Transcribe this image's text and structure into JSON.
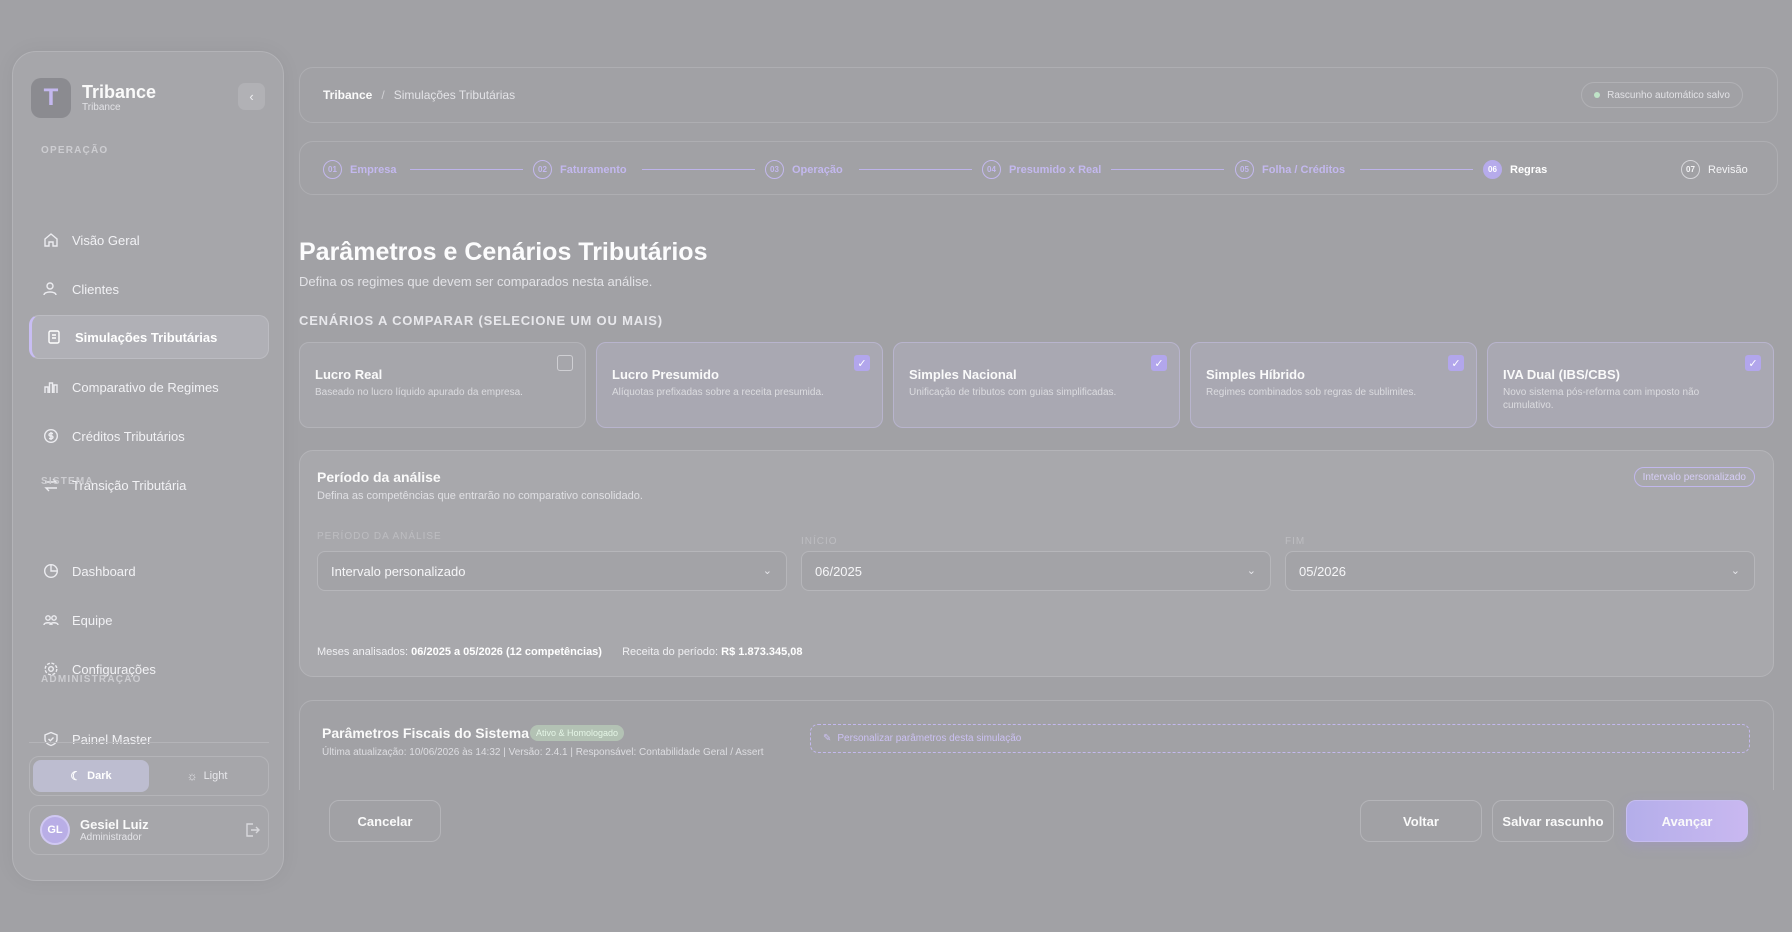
{
  "brand": {
    "name": "Tribance",
    "sub": "Tribance",
    "logo_letter": "T"
  },
  "sidebar": {
    "sections": {
      "operacao": "OPERAÇÃO",
      "sistema": "SISTEMA",
      "admin": "ADMINISTRAÇÃO"
    },
    "items": [
      {
        "label": "Visão Geral",
        "icon": "home-icon"
      },
      {
        "label": "Clientes",
        "icon": "users-icon"
      },
      {
        "label": "Simulações Tributárias",
        "icon": "document-icon"
      },
      {
        "label": "Comparativo de Regimes",
        "icon": "bar-chart-icon"
      },
      {
        "label": "Créditos Tributários",
        "icon": "dollar-icon"
      },
      {
        "label": "Transição Tributária",
        "icon": "swap-icon"
      },
      {
        "label": "Dashboard",
        "icon": "pie-chart-icon"
      },
      {
        "label": "Equipe",
        "icon": "team-icon"
      },
      {
        "label": "Configurações",
        "icon": "gear-icon"
      },
      {
        "label": "Painel Master",
        "icon": "shield-icon"
      }
    ],
    "theme": {
      "dark": "Dark",
      "light": "Light"
    },
    "user": {
      "initials": "GL",
      "name": "Gesiel Luiz",
      "role": "Administrador"
    }
  },
  "header": {
    "breadcrumb_root": "Tribance",
    "breadcrumb_current": "Simulações Tributárias",
    "autosave": "Rascunho automático salvo"
  },
  "steps": [
    {
      "num": "01",
      "label": "Empresa"
    },
    {
      "num": "02",
      "label": "Faturamento"
    },
    {
      "num": "03",
      "label": "Operação"
    },
    {
      "num": "04",
      "label": "Presumido x Real"
    },
    {
      "num": "05",
      "label": "Folha / Créditos"
    },
    {
      "num": "06",
      "label": "Regras"
    },
    {
      "num": "07",
      "label": "Revisão"
    }
  ],
  "main": {
    "title": "Parâmetros e Cenários Tributários",
    "subtitle": "Defina os regimes que devem ser comparados nesta análise.",
    "scenarios_label": "CENÁRIOS A COMPARAR (SELECIONE UM OU MAIS)",
    "scenarios": [
      {
        "title": "Lucro Real",
        "desc": "Baseado no lucro líquido apurado da empresa.",
        "checked": false
      },
      {
        "title": "Lucro Presumido",
        "desc": "Alíquotas prefixadas sobre a receita presumida.",
        "checked": true
      },
      {
        "title": "Simples Nacional",
        "desc": "Unificação de tributos com guias simplificadas.",
        "checked": true
      },
      {
        "title": "Simples Híbrido",
        "desc": "Regimes combinados sob regras de sublimites.",
        "checked": true
      },
      {
        "title": "IVA Dual (IBS/CBS)",
        "desc": "Novo sistema pós-reforma com imposto não cumulativo.",
        "checked": true
      }
    ],
    "check_glyph": "✓"
  },
  "period": {
    "title": "Período da análise",
    "subtitle": "Defina as competências que entrarão no comparativo consolidado.",
    "badge": "Intervalo personalizado",
    "label_periodo": "PERÍODO DA ANÁLISE",
    "label_inicio": "INÍCIO",
    "label_fim": "FIM",
    "periodo_value": "Intervalo personalizado",
    "inicio_value": "06/2025",
    "fim_value": "05/2026",
    "meses_label": "Meses analisados:",
    "meses_value": "06/2025 a 05/2026 (12 competências)",
    "receita_label": "Receita do período:",
    "receita_value": "R$ 1.873.345,08"
  },
  "fiscal": {
    "title": "Parâmetros Fiscais do Sistema",
    "badge": "Ativo & Homologado",
    "meta": "Última atualização: 10/06/2026 às 14:32 | Versão: 2.4.1 | Responsável: Contabilidade Geral / Assert",
    "personalize": "Personalizar parâmetros desta simulação"
  },
  "footer": {
    "cancel": "Cancelar",
    "back": "Voltar",
    "save": "Salvar rascunho",
    "next": "Avançar"
  }
}
